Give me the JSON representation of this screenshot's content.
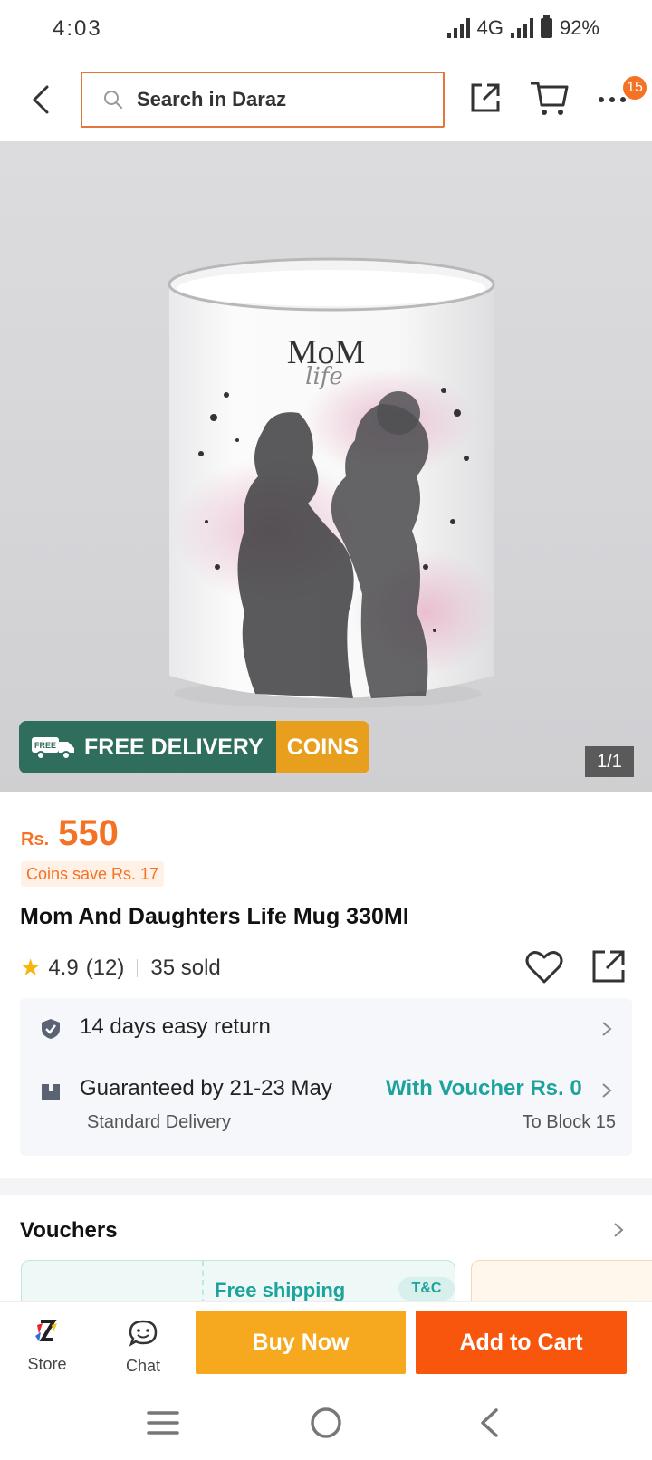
{
  "status_bar": {
    "time": "4:03",
    "network": "4G",
    "battery": "92%"
  },
  "header": {
    "search_placeholder": "Search in Daraz",
    "menu_badge": "15",
    "icons": [
      "back-icon",
      "search-icon",
      "share-icon",
      "cart-icon",
      "more-icon"
    ]
  },
  "gallery": {
    "mug_text": "MoM",
    "mug_script": "life",
    "promo_free_tag": "FREE",
    "promo_free": "FREE DELIVERY",
    "promo_coins": "COINS",
    "counter": "1/1"
  },
  "product": {
    "currency": "Rs.",
    "price": "550",
    "coins_save": "Coins save Rs. 17",
    "title": "Mom And Daughters Life Mug 330Ml",
    "rating": "4.9",
    "reviews": "(12)",
    "sold": "35 sold"
  },
  "service": {
    "return_label": "14 days easy return",
    "delivery_label": "Guaranteed by 21-23 May",
    "voucher_link": "With Voucher Rs. 0",
    "delivery_type": "Standard Delivery",
    "location": "To Block 15"
  },
  "vouchers": {
    "title": "Vouchers",
    "card1_title": "Free shipping",
    "card1_tc": "T&C"
  },
  "actions": {
    "store": "Store",
    "chat": "Chat",
    "buy_now": "Buy Now",
    "add_to_cart": "Add to Cart"
  },
  "colors": {
    "brand_orange": "#f57224",
    "buy_now": "#f6a81e",
    "add_to_cart": "#f7560c",
    "teal": "#1ba39c",
    "free_delivery_green": "#2f6d5c"
  }
}
